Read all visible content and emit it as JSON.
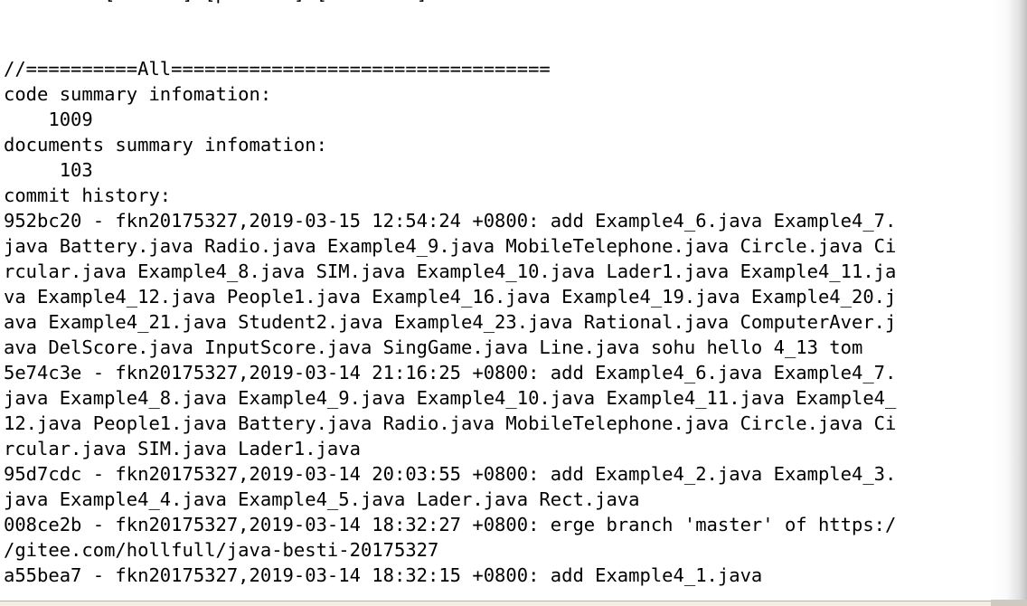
{
  "terminal": {
    "lines": [
      "         [--null] [pattern] [file ...]",
      "",
      "",
      "//==========All==================================",
      "code summary infomation:",
      "    1009",
      "documents summary infomation:",
      "     103",
      "commit history:",
      "952bc20 - fkn20175327,2019-03-15 12:54:24 +0800: add Example4_6.java Example4_7.",
      "java Battery.java Radio.java Example4_9.java MobileTelephone.java Circle.java Ci",
      "rcular.java Example4_8.java SIM.java Example4_10.java Lader1.java Example4_11.ja",
      "va Example4_12.java People1.java Example4_16.java Example4_19.java Example4_20.j",
      "ava Example4_21.java Student2.java Example4_23.java Rational.java ComputerAver.j",
      "ava DelScore.java InputScore.java SingGame.java Line.java sohu hello 4_13 tom",
      "5e74c3e - fkn20175327,2019-03-14 21:16:25 +0800: add Example4_6.java Example4_7.",
      "java Example4_8.java Example4_9.java Example4_10.java Example4_11.java Example4_",
      "12.java People1.java Battery.java Radio.java MobileTelephone.java Circle.java Ci",
      "rcular.java SIM.java Lader1.java",
      "95d7cdc - fkn20175327,2019-03-14 20:03:55 +0800: add Example4_2.java Example4_3.",
      "java Example4_4.java Example4_5.java Lader.java Rect.java",
      "008ce2b - fkn20175327,2019-03-14 18:32:27 +0800: erge branch 'master' of https:/",
      "/gitee.com/hollfull/java-besti-20175327",
      "a55bea7 - fkn20175327,2019-03-14 18:32:15 +0800: add Example4_1.java"
    ],
    "summary": {
      "code_label": "code summary infomation:",
      "code_count": "1009",
      "documents_label": "documents summary infomation:",
      "documents_count": "103",
      "commit_history_label": "commit history:",
      "section_divider": "//==========All==================================",
      "usage_fragment": "[--null] [pattern] [file ...]"
    },
    "commits": [
      {
        "hash": "952bc20",
        "author": "fkn20175327",
        "date": "2019-03-15",
        "time": "12:54:24",
        "timezone": "+0800",
        "message": "add Example4_6.java Example4_7.java Battery.java Radio.java Example4_9.java MobileTelephone.java Circle.java Circular.java Example4_8.java SIM.java Example4_10.java Lader1.java Example4_11.java Example4_12.java People1.java Example4_16.java Example4_19.java Example4_20.java Example4_21.java Student2.java Example4_23.java Rational.java ComputerAver.java DelScore.java InputScore.java SingGame.java Line.java sohu hello 4_13 tom"
      },
      {
        "hash": "5e74c3e",
        "author": "fkn20175327",
        "date": "2019-03-14",
        "time": "21:16:25",
        "timezone": "+0800",
        "message": "add Example4_6.java Example4_7.java Example4_8.java Example4_9.java Example4_10.java Example4_11.java Example4_12.java People1.java Battery.java Radio.java MobileTelephone.java Circle.java Circular.java SIM.java Lader1.java"
      },
      {
        "hash": "95d7cdc",
        "author": "fkn20175327",
        "date": "2019-03-14",
        "time": "20:03:55",
        "timezone": "+0800",
        "message": "add Example4_2.java Example4_3.java Example4_4.java Example4_5.java Lader.java Rect.java"
      },
      {
        "hash": "008ce2b",
        "author": "fkn20175327",
        "date": "2019-03-14",
        "time": "18:32:27",
        "timezone": "+0800",
        "message": "erge branch 'master' of https://gitee.com/hollfull/java-besti-20175327"
      },
      {
        "hash": "a55bea7",
        "author": "fkn20175327",
        "date": "2019-03-14",
        "time": "18:32:15",
        "timezone": "+0800",
        "message": "add Example4_1.java"
      }
    ],
    "colors": {
      "background": "#ffffff",
      "text": "#000000",
      "edge_shadow": "#bcbcbc",
      "bottom_edge": "#f3ede2"
    }
  }
}
